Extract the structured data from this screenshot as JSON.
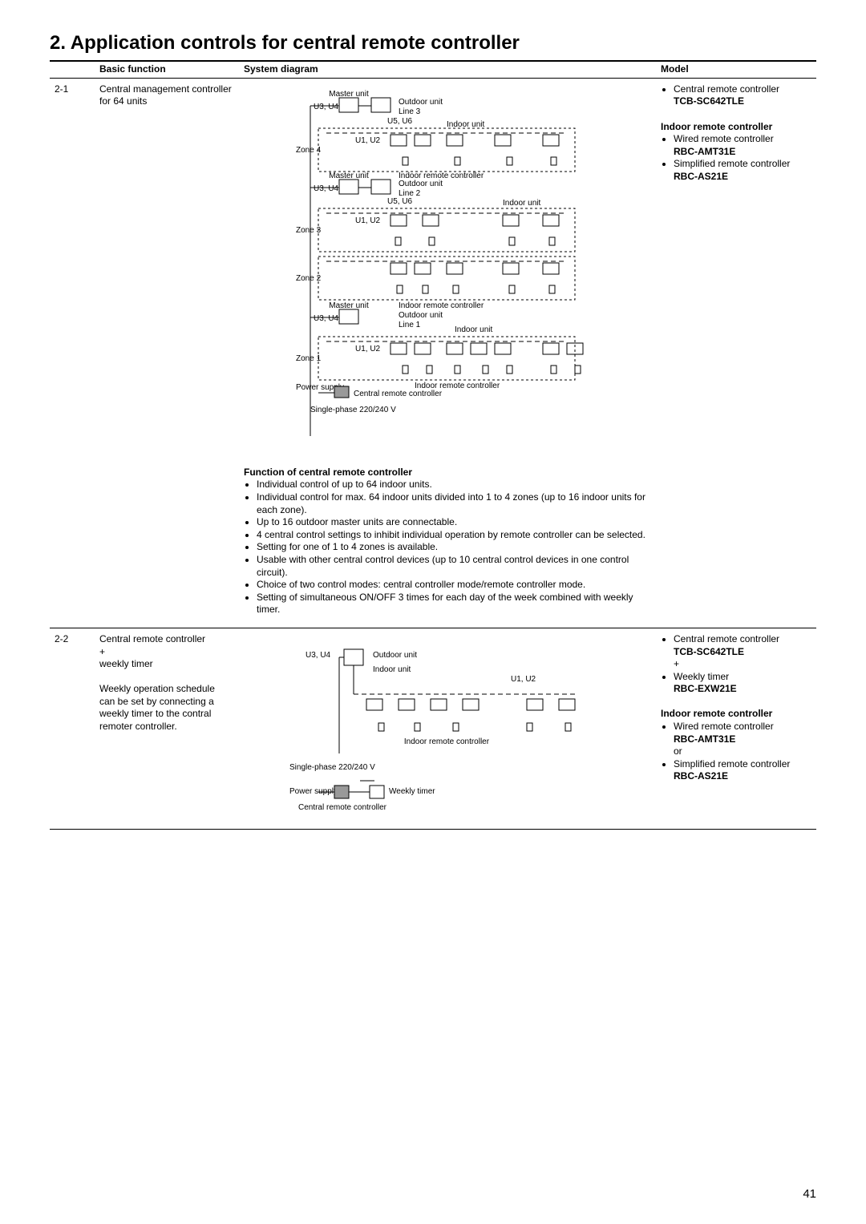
{
  "pageNumber": "41",
  "heading": "2.  Application controls for central remote controller",
  "headers": {
    "num": "",
    "func": "Basic function",
    "diag": "System diagram",
    "model": "Model"
  },
  "rows": [
    {
      "num": "2-1",
      "basic": {
        "title": "Central management controller for 64 units"
      },
      "diagram": {
        "zones": [
          "Zone 4",
          "Zone 3",
          "Zone 2",
          "Zone 1"
        ],
        "masterUnit": "Master unit",
        "outdoorUnit": "Outdoor unit",
        "indoorUnit": "Indoor unit",
        "indoorRC": "Indoor remote controller",
        "u3u4": "U3, U4",
        "u5u6": "U5, U6",
        "u1u2": "U1, U2",
        "line3": "Line 3",
        "line2": "Line 2",
        "line1": "Line 1",
        "central": "Central remote controller",
        "power": "Power supply",
        "phase": "Single-phase 220/240 V",
        "funcHead": "Function of central remote controller",
        "funcItems": [
          "Individual control of up to 64 indoor units.",
          "Individual control for max. 64 indoor units divided into 1 to 4 zones (up to 16 indoor units for each zone).",
          "Up to 16 outdoor master units are connectable.",
          "4 central control settings to inhibit individual operation by remote controller can be selected.",
          "Setting for one of 1 to 4 zones is available.",
          "Usable with other central control devices (up to 10 central control devices in one control circuit).",
          "Choice of two control modes: central controller mode/remote controller mode.",
          "Setting of simultaneous ON/OFF 3 times for each day of the week combined with weekly timer."
        ]
      },
      "model": {
        "lines": [
          {
            "text": "Central remote controller",
            "bold": false,
            "bullet": true
          },
          {
            "text": "TCB-SC642TLE",
            "bold": true,
            "bullet": false
          }
        ],
        "sub": {
          "head": "Indoor remote controller",
          "items": [
            {
              "text": "Wired remote controller",
              "bold": false,
              "bullet": true
            },
            {
              "text": "RBC-AMT31E",
              "bold": true,
              "bullet": false
            },
            {
              "text": "Simplified remote controller",
              "bold": false,
              "bullet": true
            },
            {
              "text": "RBC-AS21E",
              "bold": true,
              "bullet": false
            }
          ]
        }
      }
    },
    {
      "num": "2-2",
      "basic": {
        "title": "Central remote controller",
        "plus": "+",
        "title2": "weekly timer",
        "note": "Weekly operation schedule can be set by connecting a weekly timer to the contral remoter controller."
      },
      "diagram": {
        "u3u4": "U3, U4",
        "u1u2": "U1, U2",
        "outdoorUnit": "Outdoor unit",
        "indoorUnit": "Indoor unit",
        "indoorRC": "Indoor remote controller",
        "phase": "Single-phase 220/240 V",
        "power": "Power supply",
        "weekly": "Weekly timer",
        "central": "Central remote controller"
      },
      "model": {
        "lines": [
          {
            "text": "Central remote controller",
            "bold": false,
            "bullet": true
          },
          {
            "text": "TCB-SC642TLE",
            "bold": true,
            "bullet": false
          },
          {
            "text": "+",
            "bold": false,
            "bullet": false
          },
          {
            "text": "Weekly timer",
            "bold": false,
            "bullet": true
          },
          {
            "text": "RBC-EXW21E",
            "bold": true,
            "bullet": false
          }
        ],
        "sub": {
          "head": "Indoor remote controller",
          "items": [
            {
              "text": "Wired remote controller",
              "bold": false,
              "bullet": true
            },
            {
              "text": "RBC-AMT31E",
              "bold": true,
              "bullet": false
            },
            {
              "text": "or",
              "bold": false,
              "bullet": false
            },
            {
              "text": "Simplified remote controller",
              "bold": false,
              "bullet": true
            },
            {
              "text": "RBC-AS21E",
              "bold": true,
              "bullet": false
            }
          ]
        }
      }
    }
  ]
}
